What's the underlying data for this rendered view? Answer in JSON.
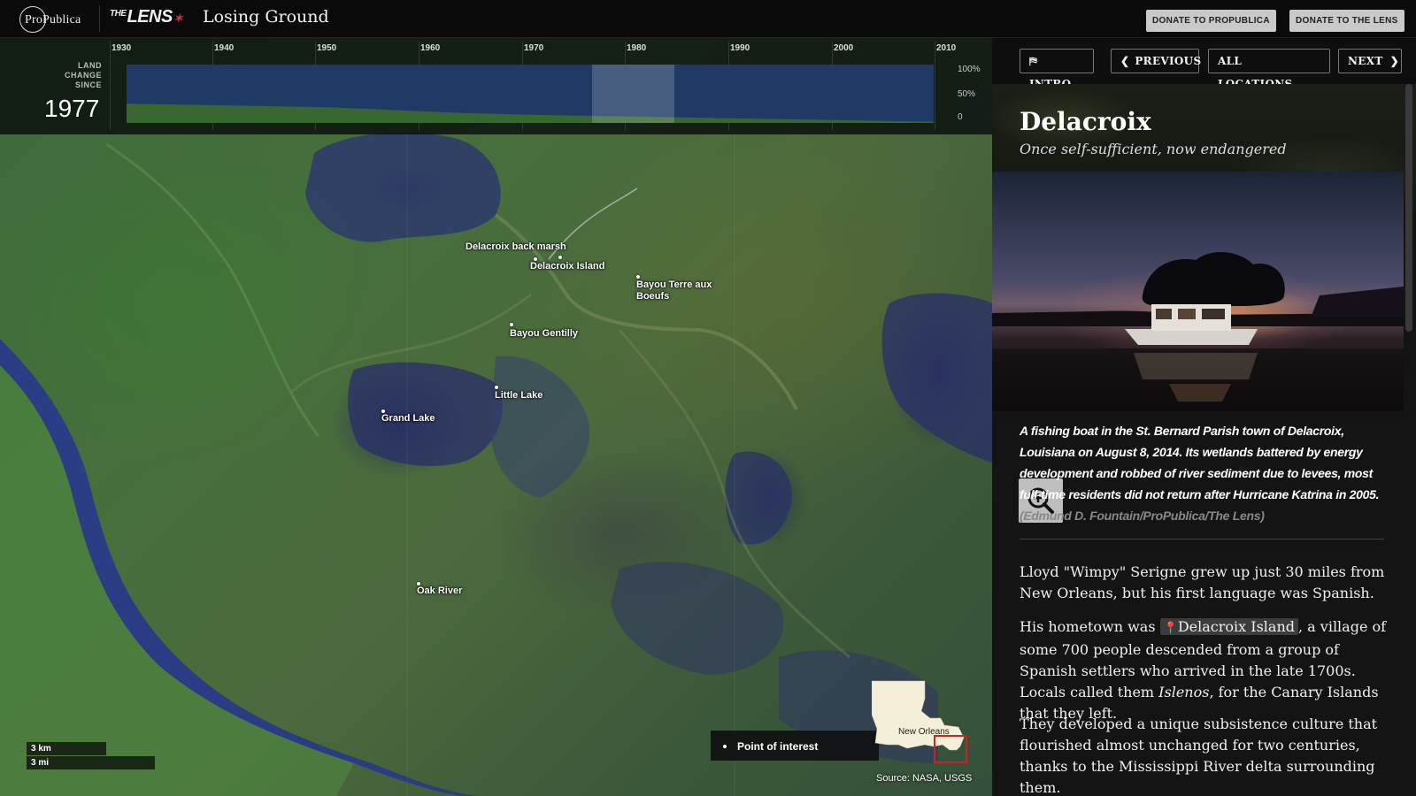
{
  "header": {
    "publisher_logo": "ProPublica",
    "partner_logo_prefix": "THE",
    "partner_logo": "LENS",
    "title": "Losing Ground",
    "donate_propublica": "DONATE TO PROPUBLICA",
    "donate_lens": "DONATE TO THE LENS"
  },
  "timeline": {
    "years": [
      "1930",
      "1940",
      "1950",
      "1960",
      "1970",
      "1980",
      "1990",
      "2000",
      "2010"
    ],
    "label": "LAND CHANGE SINCE",
    "selected_year": "1977",
    "pct_labels": [
      "100%",
      "50%",
      "0"
    ],
    "land_remaining_fraction": [
      0.33,
      0.31,
      0.29,
      0.27,
      0.22,
      0.17,
      0.14,
      0.12,
      0.1,
      0.08,
      0.06,
      0.04,
      0.02
    ],
    "colors": {
      "water": "#1f3a64",
      "land": "#3a6632",
      "highlight": "#ffffff"
    }
  },
  "map": {
    "points_of_interest": [
      "Delacroix back marsh",
      "Delacroix Island",
      "Bayou Terre aux Boeufs",
      "Bayou Gentilly",
      "Little Lake",
      "Grand Lake",
      "Oak River"
    ],
    "scale_km": "3 km",
    "scale_mi": "3 mi",
    "legend_label": "Point of interest",
    "source": "Source: NASA, USGS",
    "locator_label": "New Orleans"
  },
  "nav": {
    "intro": "INTRO",
    "previous": "PREVIOUS",
    "all_locations": "ALL LOCATIONS",
    "next": "NEXT"
  },
  "location": {
    "title": "Delacroix",
    "subtitle": "Once self-sufficient, now endangered",
    "caption": "A fishing boat in the St. Bernard Parish town of Delacroix, Louisiana on August 8, 2014. Its wetlands battered by energy development and robbed of river sediment due to levees, most full-time residents did not return after Hurricane Katrina in 2005.",
    "credit": "(Edmund D. Fountain/ProPublica/The Lens)",
    "para1": "Lloyd \"Wimpy\" Serigne grew up just 30 miles from New Orleans, but his first language was Spanish.",
    "para2_a": "His hometown was",
    "para2_link": "Delacroix Island",
    "para2_b": ", a village of some 700 people descended from a group of Spanish settlers who arrived in the late 1700s. Locals called them",
    "para2_em": "Islenos",
    "para2_c": ", for the Canary Islands that they left.",
    "para3": "They developed a unique subsistence culture that flourished almost unchanged for two centuries, thanks to the Mississippi River delta surrounding them."
  }
}
